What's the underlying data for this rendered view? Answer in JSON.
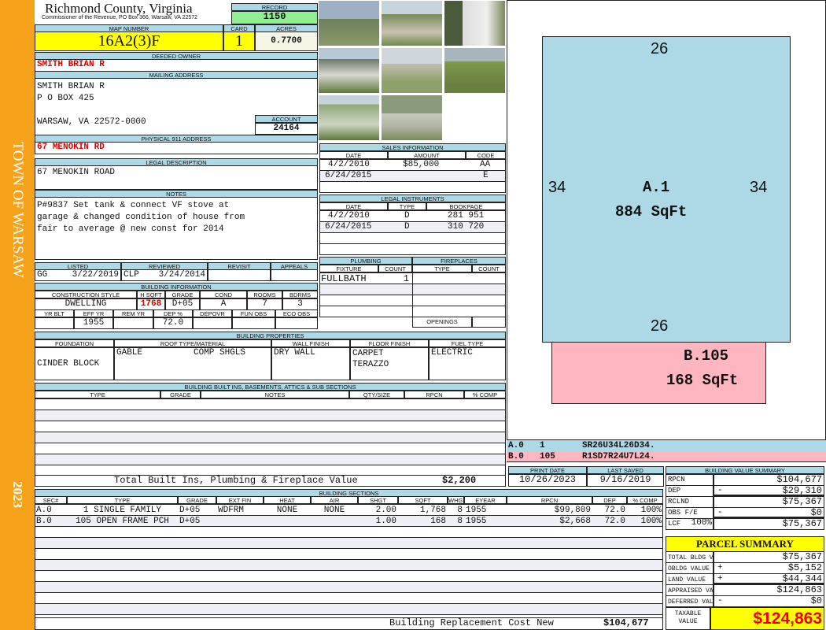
{
  "strip": {
    "town": "TOWN OF WARSAW",
    "year": "2023"
  },
  "header": {
    "county": "Richmond County, Virginia",
    "subtitle": "Commissioner of the Revenue, PO Box 366, Warsaw, VA 22572",
    "record_label": "RECORD",
    "record": "1150"
  },
  "map": {
    "map_label": "MAP NUMBER",
    "map_number": "16A2(3)F",
    "card_label": "CARD",
    "card": "1",
    "acres_label": "ACRES",
    "acres": "0.7700"
  },
  "owner": {
    "label": "DEEDED OWNER",
    "name": "SMITH BRIAN R"
  },
  "mailing": {
    "label": "MAILING ADDRESS",
    "line1": "SMITH BRIAN R",
    "line2": "P O BOX 425",
    "line3": "WARSAW, VA 22572-0000",
    "account_label": "ACCOUNT",
    "account": "24164"
  },
  "physical": {
    "label": "PHYSICAL 911 ADDRESS",
    "value": "67 MENOKIN RD"
  },
  "legal": {
    "label": "LEGAL DESCRIPTION",
    "value": "67 MENOKIN ROAD"
  },
  "notes": {
    "label": "NOTES",
    "line1": "P#9837 Set tank & connect VF stove at",
    "line2": "garage & changed condition of house from",
    "line3": "fair to average @ new const for 2014"
  },
  "listing": {
    "listed_label": "LISTED",
    "listed_by": "GG",
    "listed_date": "3/22/2019",
    "reviewed_label": "REVIEWED",
    "reviewed_by": "CLP",
    "reviewed_date": "3/24/2014",
    "revisit_label": "REVISIT",
    "appeals_label": "APPEALS"
  },
  "building_info": {
    "label": "BUILDING INFORMATION",
    "h": [
      "CONSTRUCTION STYLE",
      "H SQFT",
      "GRADE",
      "COND",
      "ROOMS",
      "BDRMS"
    ],
    "v": [
      "DWELLING",
      "1768",
      "D+05",
      "A",
      "7",
      "3"
    ],
    "h2": [
      "YR BLT",
      "EFF YR",
      "REM YR",
      "DEP %",
      "DEPOVR",
      "FUN OBS",
      "ECO OBS"
    ],
    "v2": [
      "",
      "1955",
      "",
      "72.0",
      "",
      "",
      ""
    ]
  },
  "sales": {
    "label": "SALES INFORMATION",
    "h": [
      "DATE",
      "AMOUNT",
      "CODE"
    ],
    "rows": [
      [
        "4/2/2010",
        "$85,000",
        "AA"
      ],
      [
        "6/24/2015",
        "",
        "E"
      ]
    ]
  },
  "instruments": {
    "label": "LEGAL INSTRUMENTS",
    "h": [
      "DATE",
      "TYPE",
      "BOOKPAGE"
    ],
    "rows": [
      [
        "4/2/2010",
        "D",
        "281 951"
      ],
      [
        "6/24/2015",
        "D",
        "310 720"
      ]
    ]
  },
  "plumbing": {
    "label": "PLUMBING",
    "h": [
      "FIXTURE",
      "COUNT"
    ],
    "rows": [
      [
        "FULLBATH",
        "1"
      ]
    ]
  },
  "fireplaces": {
    "label": "FIREPLACES",
    "h": [
      "TYPE",
      "COUNT"
    ],
    "openings": "OPENINGS"
  },
  "properties": {
    "label": "BUILDING PROPERTIES",
    "h": [
      "FOUNDATION",
      "ROOF TYPE/MATERIAL",
      "WALL FINISH",
      "FLOOR FINISH",
      "FUEL TYPE"
    ],
    "foundation": "CINDER BLOCK",
    "roof_type": "GABLE",
    "roof_material": "COMP SHGLS",
    "wall": "DRY WALL",
    "floor1": "CARPET",
    "floor2": "TERAZZO",
    "fuel": "ELECTRIC"
  },
  "builtins": {
    "label": "BUILDING BUILT INS, BASEMENTS, ATTICS & SUB SECTIONS",
    "h": [
      "TYPE",
      "GRADE",
      "NOTES",
      "QTY/SIZE",
      "RPCN",
      "% COMP"
    ],
    "total_label": "Total Built Ins, Plumbing & Fireplace Value",
    "total": "$2,200"
  },
  "sections": {
    "label": "BUILDING SECTIONS",
    "h": [
      "SEC#",
      "TYPE",
      "GRADE",
      "EXT FIN",
      "HEAT",
      "AIR",
      "SHGT",
      "SQFT",
      "WHGT",
      "EYEAR",
      "RPCN",
      "DEP",
      "% COMP"
    ],
    "rows": [
      [
        "A.0",
        "1 SINGLE FAMILY",
        "D+05",
        "WDFRM",
        "NONE",
        "NONE",
        "2.00",
        "1,768",
        "8",
        "1955",
        "$99,809",
        "72.0",
        "100%"
      ],
      [
        "B.0",
        "105 OPEN FRAME PCH",
        "D+05",
        "",
        "",
        "",
        "1.00",
        "168",
        "8",
        "1955",
        "$2,668",
        "72.0",
        "100%"
      ]
    ],
    "replacement_label": "Building Replacement Cost New",
    "replacement": "$104,677"
  },
  "sketch": {
    "a_top": "26",
    "a_left": "34",
    "a_right": "34",
    "a_bottom": "26",
    "a_label": "A.1",
    "a_area": "884 SqFt",
    "b_label": "B.105",
    "b_area": "168 SqFt",
    "legend": [
      [
        "A.0",
        "1",
        "SR26U34L26D34."
      ],
      [
        "B.0",
        "105",
        "R1SD7R24U7L24."
      ]
    ],
    "colors": {
      "a": "#add8e6",
      "b": "#ffb6c1"
    }
  },
  "dates": {
    "print_label": "PRINT DATE",
    "print": "10/26/2023",
    "saved_label": "LAST SAVED",
    "saved": "9/16/2019"
  },
  "value_summary": {
    "label": "BUILDING VALUE SUMMARY",
    "rows": [
      [
        "RPCN",
        "",
        "$104,677"
      ],
      [
        "DEP",
        "-",
        "$29,310"
      ],
      [
        "RCLND",
        "",
        "$75,367"
      ],
      [
        "OBS F/E",
        "-",
        "$0"
      ],
      [
        "LCF",
        "100%",
        "$75,367"
      ]
    ]
  },
  "parcel": {
    "label": "PARCEL SUMMARY",
    "rows": [
      [
        "TOTAL BLDG VALUE",
        "",
        "$75,367"
      ],
      [
        "OBLDG VALUE",
        "+",
        "$5,152"
      ],
      [
        "LAND VALUE",
        "+",
        "$44,344"
      ],
      [
        "APPRAISED VALUE",
        "",
        "$124,863"
      ],
      [
        "DEFERRED VALUE",
        "-",
        "$0"
      ]
    ],
    "taxable_label": "TAXABLE VALUE",
    "taxable": "$124,863"
  }
}
